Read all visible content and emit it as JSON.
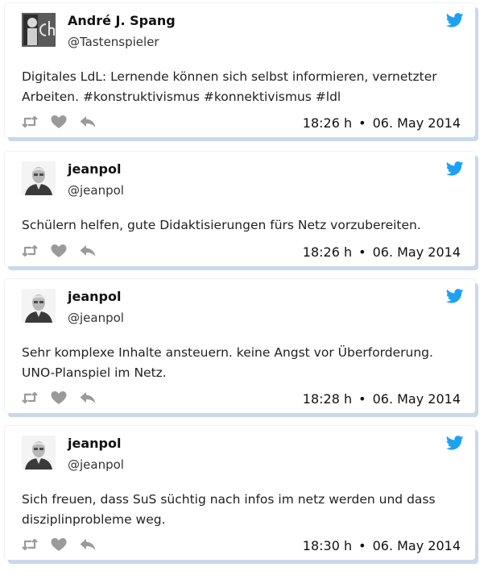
{
  "tweets": [
    {
      "author": "André J. Spang",
      "handle": "@Tastenspieler",
      "avatar": "logo-avatar",
      "text": "Digitales LdL: Lernende können sich selbst informieren, vernetzter Arbeiten. #konstruktivismus #konnektivismus #ldl",
      "time": "18:26 h",
      "separator": "•",
      "date": "06. May 2014"
    },
    {
      "author": "jeanpol",
      "handle": "@jeanpol",
      "avatar": "person-avatar",
      "text": "Schülern helfen, gute Didaktisierungen fürs Netz vorzubereiten.",
      "time": "18:26 h",
      "separator": "•",
      "date": "06. May 2014"
    },
    {
      "author": "jeanpol",
      "handle": "@jeanpol",
      "avatar": "person-avatar",
      "text": "Sehr komplexe Inhalte ansteuern. keine Angst vor Überforderung. UNO-Planspiel im Netz.",
      "time": "18:28 h",
      "separator": "•",
      "date": "06. May 2014"
    },
    {
      "author": "jeanpol",
      "handle": "@jeanpol",
      "avatar": "person-avatar",
      "text": "Sich freuen, dass SuS süchtig nach infos im netz werden und dass disziplinprobleme weg.",
      "time": "18:30 h",
      "separator": "•",
      "date": "06. May 2014"
    }
  ],
  "colors": {
    "twitter_blue": "#1da1f2",
    "icon_gray": "#9a9a9a",
    "card_shadow": "#c9d9ea"
  },
  "icons": [
    "twitter-bird-icon",
    "retweet-icon",
    "like-heart-icon",
    "reply-icon"
  ]
}
